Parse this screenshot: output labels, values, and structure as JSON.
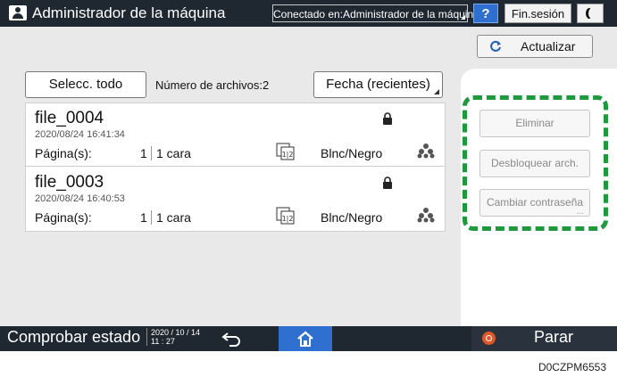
{
  "header": {
    "title": "Administrador de la máquina",
    "connected_label": "Conectado en:Administrador de la máquina",
    "help_label": "?",
    "logout_label": "Fin.sesión"
  },
  "toolbar": {
    "refresh_label": "Actualizar",
    "select_all_label": "Selecc. todo",
    "file_count": "Número de archivos:2",
    "sort_label": "Fecha (recientes)"
  },
  "files": [
    {
      "name": "file_0004",
      "datetime": "2020/08/24 16:41:34",
      "pages_label": "Página(s):",
      "pages": "1",
      "sides": "1 cara",
      "sides_icon_text": "1|2",
      "color_mode": "Blnc/Negro"
    },
    {
      "name": "file_0003",
      "datetime": "2020/08/24 16:40:53",
      "pages_label": "Página(s):",
      "pages": "1",
      "sides": "1 cara",
      "sides_icon_text": "1|2",
      "color_mode": "Blnc/Negro"
    }
  ],
  "actions": {
    "delete_label": "Eliminar",
    "unlock_label": "Desbloquear arch.",
    "change_password_label": "Cambiar contraseña"
  },
  "footer": {
    "status_label": "Comprobar estado",
    "date": "2020 / 10 / 14",
    "time": "11 : 27",
    "stop_label": "Parar"
  },
  "caption": "D0CZPM6553",
  "colors": {
    "bar": "#1f2730",
    "accent_blue": "#2f6fd0",
    "highlight_green": "#1e9a3c",
    "stop_orange": "#e0572a"
  },
  "icons": [
    "user-icon",
    "moon-icon",
    "refresh-icon",
    "lock-icon",
    "sides-icon",
    "group-icon",
    "back-icon",
    "home-icon",
    "stop-icon"
  ]
}
